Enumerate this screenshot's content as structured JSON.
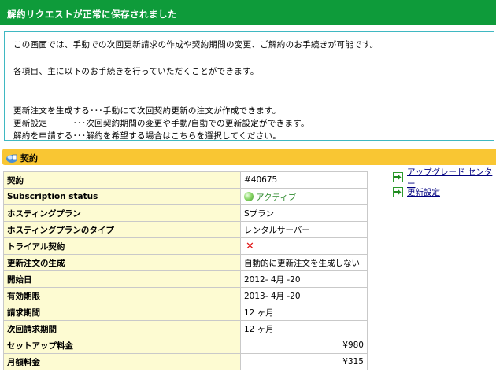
{
  "banner": {
    "title": "解約リクエストが正常に保存されました"
  },
  "info": {
    "line1": "この画面では、手動での次回更新請求の作成や契約期間の変更、ご解約のお手続きが可能です。",
    "line2": "各項目、主に以下のお手続きを行っていただくことができます。",
    "line3": "更新注文を生成する･･･手動にて次回契約更新の注文が作成できます。",
    "line4": "更新設定　　　･･･次回契約期間の変更や手動/自動での更新設定ができます。",
    "line5": "解約を申請する･･･解約を希望する場合はこちらを選択してください。"
  },
  "section": {
    "title": "契約",
    "icon": "contract-icon"
  },
  "details": {
    "contract": {
      "label": "契約",
      "value": "#40675"
    },
    "status": {
      "label": "Subscription status",
      "value": "アクティブ",
      "icon": "green-ball-icon"
    },
    "plan": {
      "label": "ホスティングプラン",
      "value": "Sプラン"
    },
    "plan_type": {
      "label": "ホスティングプランのタイプ",
      "value": "レンタルサーバー"
    },
    "trial": {
      "label": "トライアル契約",
      "value": "✕",
      "icon": "red-x-icon"
    },
    "renewal": {
      "label": "更新注文の生成",
      "value": "自動的に更新注文を生成しない"
    },
    "start": {
      "label": "開始日",
      "value": "2012- 4月 -20"
    },
    "expiry": {
      "label": "有効期限",
      "value": "2013- 4月 -20"
    },
    "billing_period": {
      "label": "請求期間",
      "value": "12 ヶ月"
    },
    "next_billing_period": {
      "label": "次回請求期間",
      "value": "12 ヶ月"
    },
    "setup_fee": {
      "label": "セットアップ料金",
      "value": "¥980"
    },
    "monthly_fee": {
      "label": "月額料金",
      "value": "¥315"
    }
  },
  "side": {
    "upgrade": "アップグレード センター",
    "renewal_settings": "更新設定"
  },
  "colors": {
    "banner": "#0e9b3a",
    "section": "#f9c633",
    "label_bg": "#fdfbd2",
    "info_border": "#3fb8c2",
    "link": "#000080",
    "active": "#2e8a2e",
    "cross": "#e01515"
  }
}
